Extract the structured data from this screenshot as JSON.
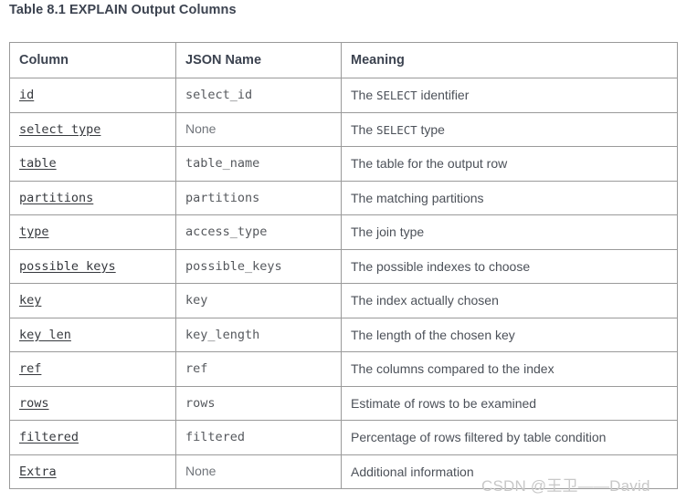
{
  "title": "Table 8.1 EXPLAIN Output Columns",
  "table": {
    "headers": {
      "column": "Column",
      "json_name": "JSON Name",
      "meaning": "Meaning"
    },
    "rows": [
      {
        "column": "id",
        "json_name": "select_id",
        "json_name_is_none": false,
        "meaning_pre": "The ",
        "meaning_code": "SELECT",
        "meaning_post": " identifier"
      },
      {
        "column": "select type",
        "json_name": "None",
        "json_name_is_none": true,
        "meaning_pre": "The ",
        "meaning_code": "SELECT",
        "meaning_post": " type"
      },
      {
        "column": "table",
        "json_name": "table_name",
        "json_name_is_none": false,
        "meaning_pre": "The table for the output row",
        "meaning_code": "",
        "meaning_post": ""
      },
      {
        "column": "partitions",
        "json_name": "partitions",
        "json_name_is_none": false,
        "meaning_pre": "The matching partitions",
        "meaning_code": "",
        "meaning_post": ""
      },
      {
        "column": "type",
        "json_name": "access_type",
        "json_name_is_none": false,
        "meaning_pre": "The join type",
        "meaning_code": "",
        "meaning_post": ""
      },
      {
        "column": "possible keys",
        "json_name": "possible_keys",
        "json_name_is_none": false,
        "meaning_pre": "The possible indexes to choose",
        "meaning_code": "",
        "meaning_post": ""
      },
      {
        "column": "key",
        "json_name": "key",
        "json_name_is_none": false,
        "meaning_pre": "The index actually chosen",
        "meaning_code": "",
        "meaning_post": ""
      },
      {
        "column": "key len",
        "json_name": "key_length",
        "json_name_is_none": false,
        "meaning_pre": "The length of the chosen key",
        "meaning_code": "",
        "meaning_post": ""
      },
      {
        "column": "ref",
        "json_name": "ref",
        "json_name_is_none": false,
        "meaning_pre": "The columns compared to the index",
        "meaning_code": "",
        "meaning_post": ""
      },
      {
        "column": "rows",
        "json_name": "rows",
        "json_name_is_none": false,
        "meaning_pre": "Estimate of rows to be examined",
        "meaning_code": "",
        "meaning_post": ""
      },
      {
        "column": "filtered",
        "json_name": "filtered",
        "json_name_is_none": false,
        "meaning_pre": "Percentage of rows filtered by table condition",
        "meaning_code": "",
        "meaning_post": ""
      },
      {
        "column": "Extra",
        "json_name": "None",
        "json_name_is_none": true,
        "meaning_pre": "Additional information",
        "meaning_code": "",
        "meaning_post": ""
      }
    ]
  },
  "watermark": "CSDN @王卫——David",
  "colors": {
    "title_text": "#3c4350",
    "body_text": "#4c5159",
    "link_text": "#36393e",
    "border": "#9a9a9a",
    "watermark": "#c8c8c8",
    "background": "#ffffff"
  }
}
